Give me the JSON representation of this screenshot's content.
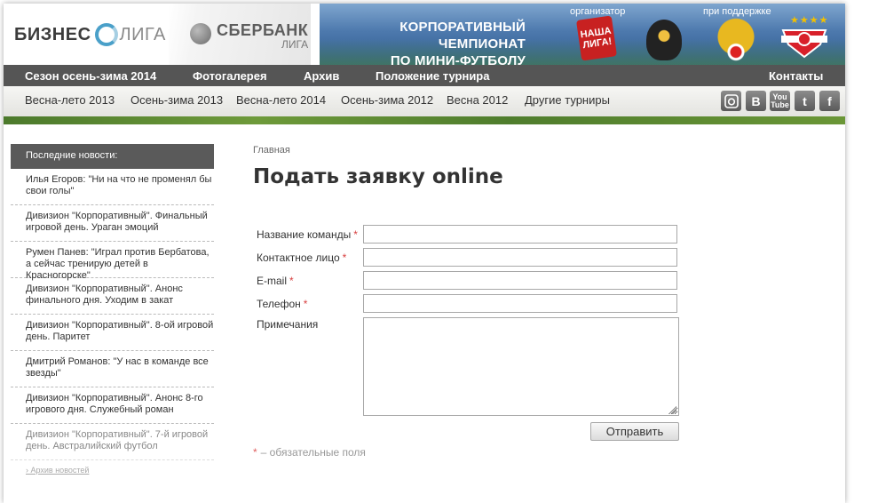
{
  "header": {
    "logo_word1": "БИЗНЕС",
    "logo_word2": "ЛИГА",
    "sponsor_name": "СБЕРБАНК",
    "sponsor_sub": "ЛИГА",
    "banner_title_line1": "КОРПОРАТИВНЫЙ ЧЕМПИОНАТ",
    "banner_title_line2": "ПО МИНИ-ФУТБОЛУ",
    "organizer_label": "организатор",
    "support_label": "при поддержке",
    "nasha_liga_logo": "НАША ЛИГА!",
    "stars": "★★★★"
  },
  "nav_primary": [
    "Сезон осень-зима 2014",
    "Фотогалерея",
    "Архив",
    "Положение турнира",
    "Контакты"
  ],
  "nav_secondary": [
    "Весна-лето 2013",
    "Осень-зима 2013",
    "Весна-лето 2014",
    "Осень-зима 2012",
    "Весна 2012",
    "Другие турниры"
  ],
  "social": {
    "icons": [
      "instagram-icon",
      "vk-icon",
      "youtube-icon",
      "twitter-icon",
      "facebook-icon"
    ],
    "vk_glyph": "B",
    "youtube_glyph": "You Tube",
    "twitter_glyph": "t",
    "facebook_glyph": "f"
  },
  "sidebar": {
    "title": "Последние новости:",
    "news": [
      "Илья Егоров: \"Ни на что не променял бы свои голы\"",
      "Дивизион \"Корпоративный\". Финальный игровой день. Ураган эмоций",
      "Румен Панев: \"Играл против Бербатова, а сейчас тренирую детей в Красногорске\"",
      "Дивизион \"Корпоративный\". Анонс финального дня. Уходим в закат",
      "Дивизион \"Корпоративный\". 8-ой игровой день. Паритет",
      "Дмитрий Романов: \"У нас в команде все звезды\"",
      "Дивизион \"Корпоративный\". Анонс 8-го игрового дня. Служебный роман",
      "Дивизион \"Корпоративный\". 7-й игровой день. Австралийский футбол"
    ],
    "archive_link": "Архив новостей"
  },
  "main": {
    "breadcrumb": "Главная",
    "title": "Подать заявку online",
    "form": {
      "team_label": "Название команды",
      "contact_label": "Контактное лицо",
      "email_label": "E-mail",
      "phone_label": "Телефон",
      "notes_label": "Примечания",
      "required_mark": "*",
      "submit_label": "Отправить",
      "required_note": "– обязательные поля",
      "team_value": "",
      "contact_value": "",
      "email_value": "",
      "phone_value": "",
      "notes_value": ""
    }
  },
  "colors": {
    "nav_dark": "#555555",
    "banner_blue": "#4d79ad",
    "required_red": "#d84040"
  }
}
